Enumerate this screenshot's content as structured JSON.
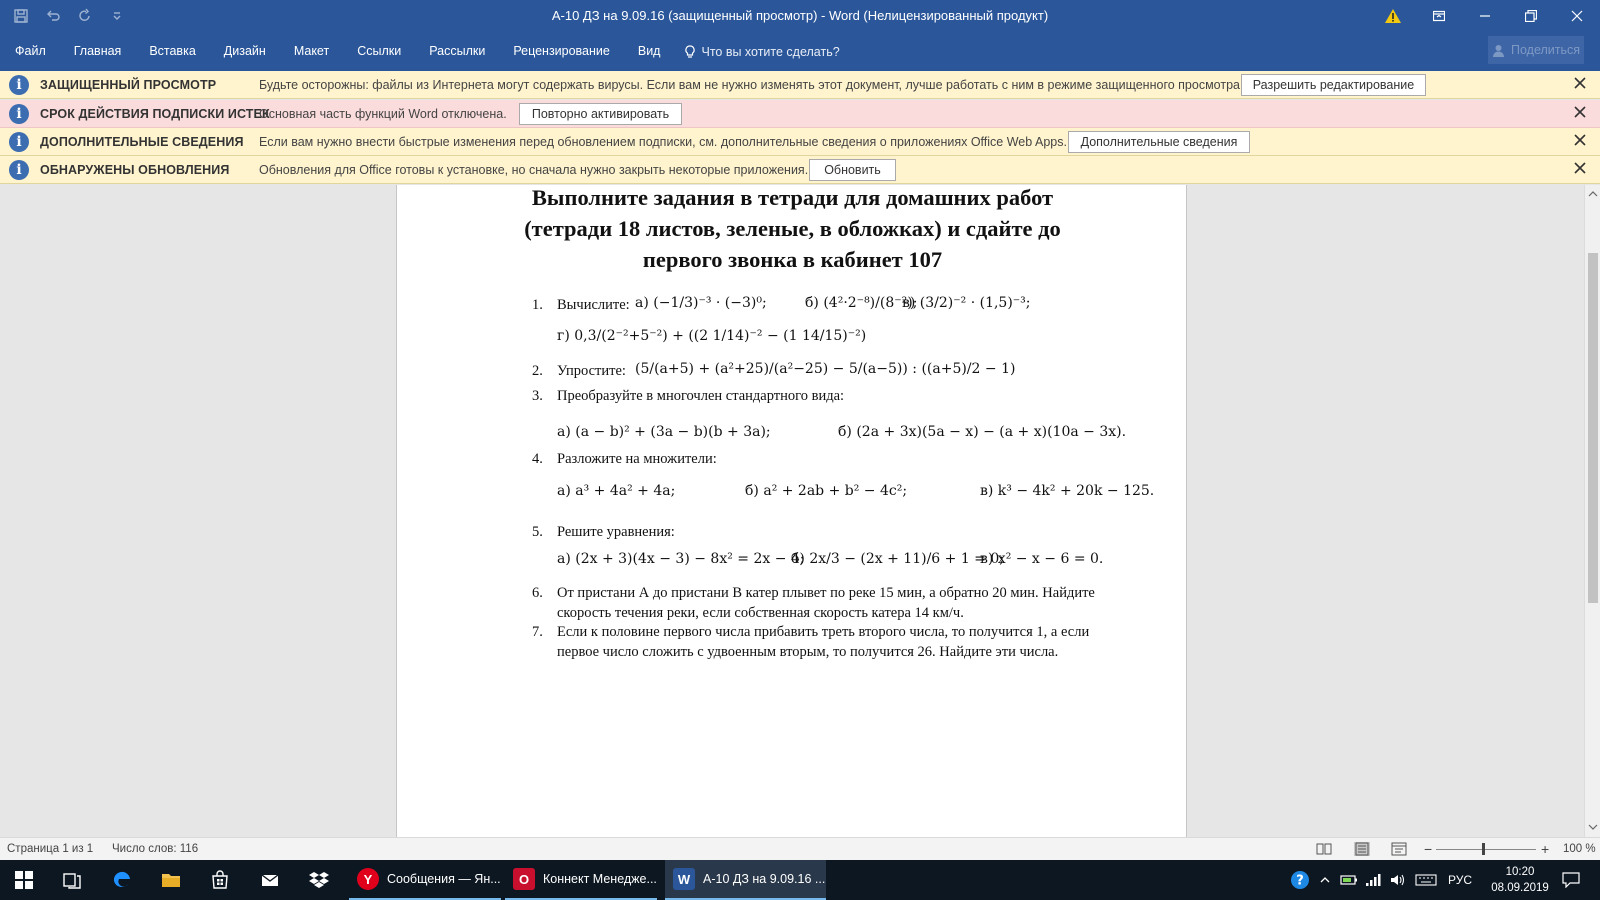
{
  "window": {
    "title": "А-10 ДЗ на 9.09.16 (защищенный просмотр)  -  Word (Нелицензированный продукт)"
  },
  "ribbon": {
    "tabs": [
      "Файл",
      "Главная",
      "Вставка",
      "Дизайн",
      "Макет",
      "Ссылки",
      "Рассылки",
      "Рецензирование",
      "Вид"
    ],
    "tell_me": "Что вы хотите сделать?",
    "share": "Поделиться"
  },
  "message_bars": [
    {
      "title": "ЗАЩИЩЕННЫЙ ПРОСМОТР",
      "text": "Будьте осторожны: файлы из Интернета могут содержать вирусы. Если вам не нужно изменять этот документ, лучше работать с ним в режиме защищенного просмотра.",
      "button": "Разрешить редактирование"
    },
    {
      "title": "СРОК ДЕЙСТВИЯ ПОДПИСКИ ИСТЕК",
      "text": "Основная часть функций Word отключена.",
      "button": "Повторно активировать"
    },
    {
      "title": "ДОПОЛНИТЕЛЬНЫЕ СВЕДЕНИЯ",
      "text": "Если вам нужно внести быстрые изменения перед обновлением подписки, см. дополнительные сведения о приложениях Office Web Apps.",
      "button": "Дополнительные сведения"
    },
    {
      "title": "ОБНАРУЖЕНЫ ОБНОВЛЕНИЯ",
      "text": "Обновления для Office готовы к установке, но сначала нужно закрыть некоторые приложения.",
      "button": "Обновить"
    }
  ],
  "document": {
    "heading": [
      "Выполните задания в тетради для домашних работ",
      "(тетради 18 листов, зеленые, в обложках) и сдайте до",
      "первого звонка в кабинет 107"
    ],
    "tasks": [
      {
        "num": "1.",
        "text": "Вычислите:"
      },
      {
        "num": "2.",
        "text": "Упростите:"
      },
      {
        "num": "3.",
        "text": "Преобразуйте в многочлен стандартного вида:"
      },
      {
        "num": "4.",
        "text": "Разложите на множители:"
      },
      {
        "num": "5.",
        "text": "Решите уравнения:"
      },
      {
        "num": "6.",
        "text": "От пристани А до пристани В катер плывет по реке 15 мин, а обратно 20 мин. Найдите",
        "text2": "скорость течения реки, если собственная скорость катера 14 км/ч."
      },
      {
        "num": "7.",
        "text": "Если к половине первого числа прибавить треть второго числа, то получится 1, а если",
        "text2": "первое число сложить с удвоенным вторым, то получится 26. Найдите эти числа."
      }
    ],
    "math": {
      "t1_a": "а) (−1/3)⁻³ · (−3)⁰;",
      "t1_b": "б) (4²·2⁻⁸)/(8⁻²);",
      "t1_v": "в) (3/2)⁻² · (1,5)⁻³;",
      "t1_g": "г) 0,3/(2⁻²+5⁻²) + ((2 1/14)⁻² − (1 14/15)⁻²)",
      "t2": "(5/(a+5) + (a²+25)/(a²−25) − 5/(a−5)) : ((a+5)/2 − 1)",
      "t3_a": "а) (a − b)² + (3a − b)(b + 3a);",
      "t3_b": "б) (2a + 3x)(5a − x) − (a + x)(10a − 3x).",
      "t4_a": "а) a³ + 4a² + 4a;",
      "t4_b": "б) a² + 2ab + b² − 4c²;",
      "t4_v": "в) k³ − 4k² + 20k − 125.",
      "t5_a": "а) (2x + 3)(4x − 3) − 8x² = 2x − 4;",
      "t5_b": "б) 2x/3 − (2x + 11)/6 + 1 = 0;",
      "t5_v": "в) x² − x − 6 = 0."
    }
  },
  "statusbar": {
    "page": "Страница 1 из 1",
    "words": "Число слов: 116",
    "zoom": "100 %",
    "zoom_level_percent": 100
  },
  "taskbar": {
    "apps": [
      {
        "label": "Сообщения — Ян...",
        "color": "#e0001b",
        "icon_text": "Y"
      },
      {
        "label": "Коннект Менедже...",
        "color": "#c8102e",
        "icon_text": "O"
      },
      {
        "label": "А-10 ДЗ на 9.09.16 ...",
        "color": "#2b579a",
        "icon_text": "W"
      }
    ],
    "lang": "РУС",
    "time": "10:20",
    "date": "08.09.2019"
  }
}
